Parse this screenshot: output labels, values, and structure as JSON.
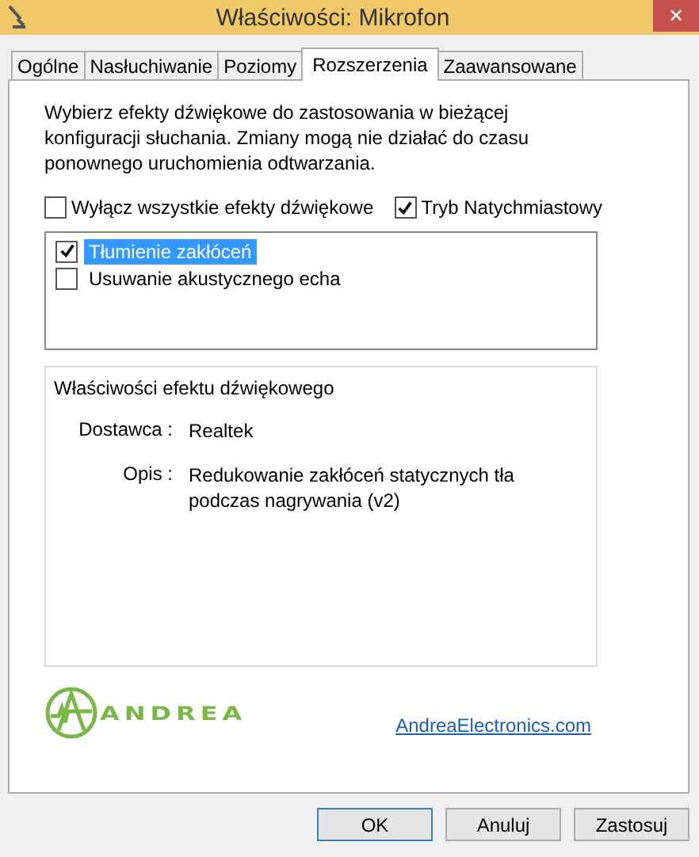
{
  "window": {
    "title": "Właściwości: Mikrofon",
    "close": "✕"
  },
  "tabs": [
    {
      "label": "Ogólne",
      "selected": false
    },
    {
      "label": "Nasłuchiwanie",
      "selected": false
    },
    {
      "label": "Poziomy",
      "selected": false
    },
    {
      "label": "Rozszerzenia",
      "selected": true
    },
    {
      "label": "Zaawansowane",
      "selected": false
    }
  ],
  "description": "Wybierz efekty dźwiękowe do zastosowania w bieżącej konfiguracji słuchania. Zmiany mogą nie działać do czasu ponownego uruchomienia odtwarzania.",
  "options": [
    {
      "label": "Wyłącz wszystkie efekty dźwiękowe",
      "checked": false
    },
    {
      "label": "Tryb Natychmiastowy",
      "checked": true
    }
  ],
  "effects": [
    {
      "label": "Tłumienie zakłóceń",
      "checked": true,
      "selected": true
    },
    {
      "label": "Usuwanie akustycznego echa",
      "checked": false,
      "selected": false
    }
  ],
  "properties": {
    "title": "Właściwości efektu dźwiękowego",
    "fields": [
      {
        "label": "Dostawca :",
        "value": "Realtek"
      },
      {
        "label": "Opis :",
        "value": "Redukowanie zakłóceń statycznych tła podczas nagrywania (v2)"
      }
    ]
  },
  "logo": {
    "text": "ANDREA"
  },
  "link": "AndreaElectronics.com",
  "buttons": [
    {
      "label": "OK",
      "default": true
    },
    {
      "label": "Anuluj",
      "default": false
    },
    {
      "label": "Zastosuj",
      "default": false
    }
  ]
}
